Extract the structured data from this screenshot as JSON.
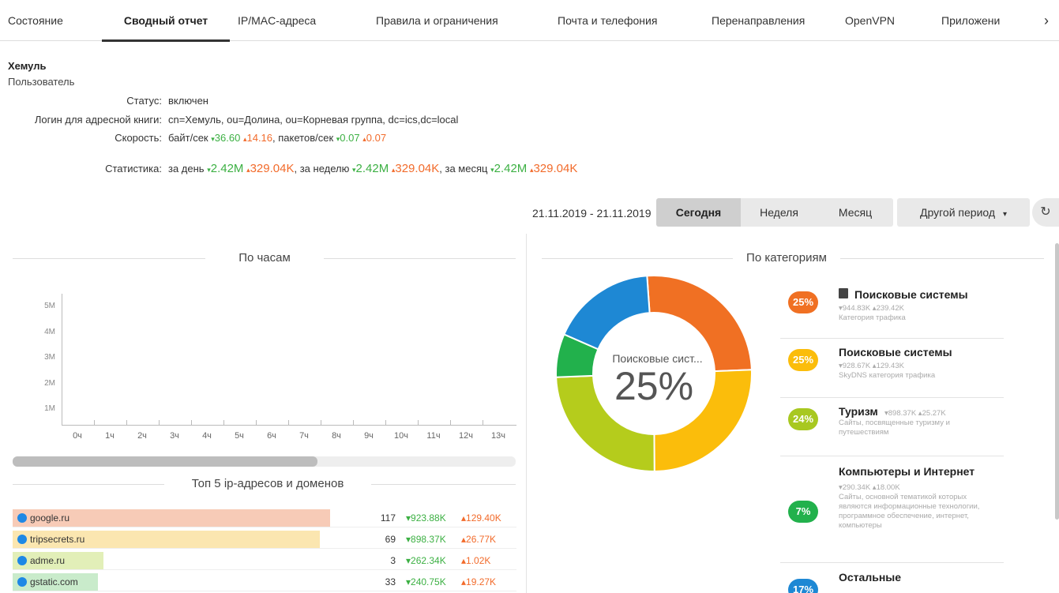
{
  "tabs": [
    "Состояние",
    "Сводный отчет",
    "IP/MAC-адреса",
    "Правила и ограничения",
    "Почта и телефония",
    "Перенаправления",
    "OpenVPN",
    "Приложени"
  ],
  "tabs_next": "›",
  "user": {
    "name": "Хемуль",
    "role": "Пользователь",
    "status_label": "Статус:",
    "status_value": "включен",
    "login_label": "Логин для адресной книги:",
    "login_value": "cn=Хемуль, ou=Долина, ou=Корневая группа, dc=ics,dc=local",
    "speed_label": "Скорость:",
    "speed_bytes_label": "байт/сек",
    "speed_bytes_down": "36.60",
    "speed_bytes_up": "14.16",
    "speed_packets_label": ", пакетов/сек",
    "speed_packets_down": "0.07",
    "speed_packets_up": "0.07",
    "stats_label": "Статистика:",
    "day_label": "за день",
    "day_down": "2.42M",
    "day_up": "329.04K",
    "week_label": ", за неделю",
    "week_down": "2.42M",
    "week_up": "329.04K",
    "month_label": ", за месяц",
    "month_down": "2.42M",
    "month_up": "329.04K"
  },
  "period": {
    "date_range": "21.11.2019 - 21.11.2019",
    "today": "Сегодня",
    "week": "Неделя",
    "month": "Месяц",
    "other": "Другой период",
    "dropdown_caret": "▾",
    "refresh_icon": "↻"
  },
  "hourly": {
    "title": "По часам",
    "y_ticks": [
      "5M",
      "4M",
      "3M",
      "2M",
      "1M"
    ],
    "x_ticks": [
      "0ч",
      "1ч",
      "2ч",
      "3ч",
      "4ч",
      "5ч",
      "6ч",
      "7ч",
      "8ч",
      "9ч",
      "10ч",
      "11ч",
      "12ч",
      "13ч"
    ]
  },
  "top5": {
    "title": "Топ 5 ip-адресов и доменов",
    "rows": [
      {
        "name": "google.ru",
        "count": "117",
        "down": "923.88K",
        "up": "129.40K",
        "color": "#f7cbb7",
        "fill": 0.63
      },
      {
        "name": "tripsecrets.ru",
        "count": "69",
        "down": "898.37K",
        "up": "26.77K",
        "color": "#fbe6b0",
        "fill": 0.61
      },
      {
        "name": "adme.ru",
        "count": "3",
        "down": "262.34K",
        "up": "1.02K",
        "color": "#e2efb8",
        "fill": 0.18
      },
      {
        "name": "gstatic.com",
        "count": "33",
        "down": "240.75K",
        "up": "19.27K",
        "color": "#c9ebcb",
        "fill": 0.17
      }
    ]
  },
  "categories": {
    "title": "По категориям",
    "center_label": "Поисковые сист...",
    "center_pct": "25%",
    "items": [
      {
        "pct": "25%",
        "title": "Поисковые системы",
        "sub1": "▾944.83K ▴239.42K",
        "sub2": "Категория трафика",
        "color": "#f07023",
        "book_icon": true
      },
      {
        "pct": "25%",
        "title": "Поисковые системы",
        "sub1": "▾928.67K ▴129.43K",
        "sub2": "SkyDNS категория трафика",
        "color": "#fbbd0b"
      },
      {
        "pct": "24%",
        "title": "Туризм",
        "sub1": "▾898.37K ▴25.27K",
        "sub2": "Сайты, посвященные туризму и путешествиям",
        "color": "#a8c820"
      },
      {
        "pct": "7%",
        "title": "Компьютеры и Интернет",
        "sub1": "▾290.34K ▴18.00K",
        "sub2": "Сайты, основной тематикой которых являются информационные технологии, программное обеспечение, интернет, компьютеры",
        "color": "#22b14c"
      },
      {
        "pct": "17%",
        "title": "Остальные",
        "sub1": "",
        "sub2": "",
        "color": "#1e88d4"
      }
    ],
    "donut": [
      {
        "name": "Поисковые системы",
        "value": 25,
        "color": "#f07023"
      },
      {
        "name": "Поисковые системы",
        "value": 25,
        "color": "#fbbd0b"
      },
      {
        "name": "Туризм",
        "value": 24,
        "color": "#b5cc1c"
      },
      {
        "name": "Компьютеры и Интернет",
        "value": 7,
        "color": "#22b14c"
      },
      {
        "name": "Остальные",
        "value": 17,
        "color": "#1e88d4"
      }
    ]
  }
}
